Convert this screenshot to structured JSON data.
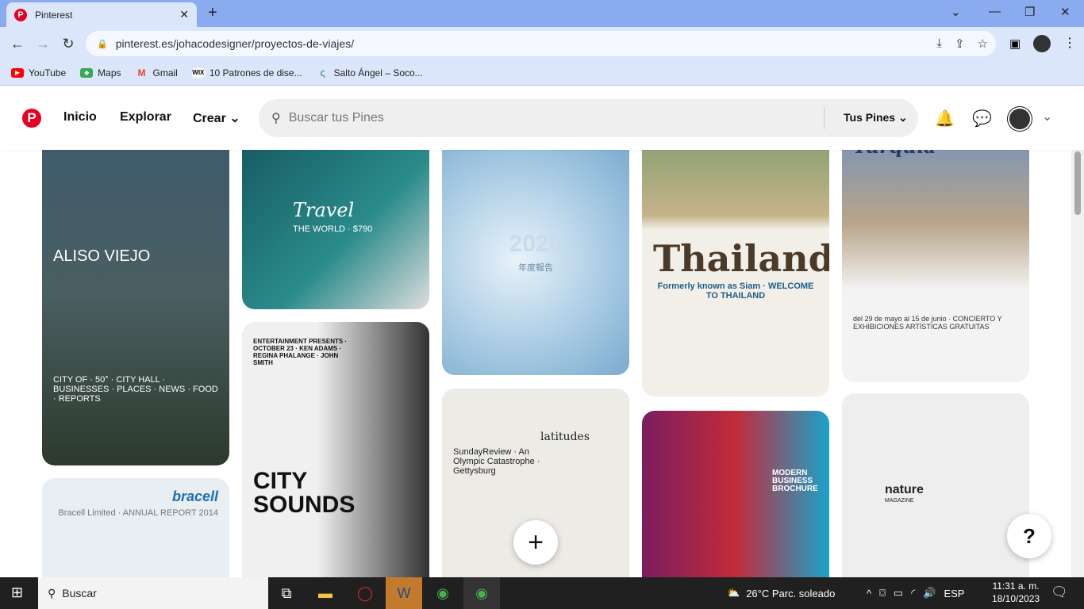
{
  "browser": {
    "tab_title": "Pinterest",
    "url": "pinterest.es/johacodesigner/proyectos-de-viajes/",
    "bookmarks": [
      {
        "label": "YouTube",
        "icon": "youtube-icon",
        "color": "#ff0000"
      },
      {
        "label": "Maps",
        "icon": "maps-icon",
        "color": "#34a853"
      },
      {
        "label": "Gmail",
        "icon": "gmail-icon",
        "color": "#ea4335"
      },
      {
        "label": "10 Patrones de dise...",
        "icon": "wix-icon",
        "color": "#000000"
      },
      {
        "label": "Salto Ángel – Soco...",
        "icon": "site-icon",
        "color": "#2a8a6a"
      }
    ]
  },
  "header": {
    "nav": [
      "Inicio",
      "Explorar",
      "Crear"
    ],
    "search_placeholder": "Buscar tus Pines",
    "tus_pines": "Tus Pines",
    "brand_color": "#e60023"
  },
  "pins": [
    {
      "title": "ALISO VIEJO",
      "subtitle": "CITY OF · 50° · CITY HALL · BUSINESSES · PLACES · NEWS · FOOD · REPORTS",
      "color": "#3c5563"
    },
    {
      "title": "bracell",
      "subtitle": "Bracell Limited · ANNUAL REPORT 2014",
      "color": "#e9eef2"
    },
    {
      "title": "Travel",
      "subtitle": "THE WORLD · $790",
      "color": "#1f6f78"
    },
    {
      "title": "CITY SOUNDS",
      "subtitle": "ENTERTAINMENT PRESENTS · OCTOBER 23 · KEN ADAMS · REGINA PHALANGE · JOHN SMITH",
      "color": "#3a3a3a"
    },
    {
      "title": "2020",
      "subtitle": "年度報告",
      "color": "#9cc3de"
    },
    {
      "title": "latitudes",
      "subtitle": "SundayReview · An Olympic Catastrophe · Gettysburg",
      "color": "#e8e6e0"
    },
    {
      "title": "Thailand",
      "subtitle": "Formerly known as Siam · WELCOME TO THAILAND",
      "color": "#f2efe8"
    },
    {
      "title": "MODERN BUSINESS BROCHURE",
      "subtitle": "",
      "color": "#c9d0d8"
    },
    {
      "title": "Turquía",
      "subtitle": "del 29 de mayo al 15 de junio · CONCIERTO Y EXHIBICIONES ARTÍSTICAS GRATUITAS",
      "color": "#b9a58a"
    },
    {
      "title": "nature",
      "subtitle": "MAGAZINE",
      "color": "#eeeeee"
    }
  ],
  "taskbar": {
    "search": "Buscar",
    "weather": "26°C  Parc. soleado",
    "language": "ESP",
    "time": "11:31 a. m.",
    "date": "18/10/2023"
  }
}
